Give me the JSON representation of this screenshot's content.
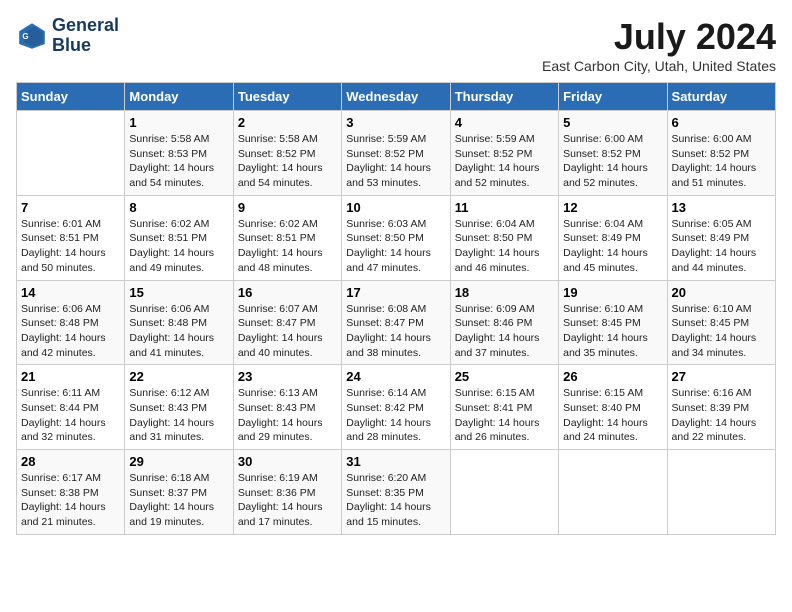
{
  "logo": {
    "line1": "General",
    "line2": "Blue"
  },
  "title": "July 2024",
  "location": "East Carbon City, Utah, United States",
  "days_header": [
    "Sunday",
    "Monday",
    "Tuesday",
    "Wednesday",
    "Thursday",
    "Friday",
    "Saturday"
  ],
  "weeks": [
    [
      {
        "num": "",
        "info": ""
      },
      {
        "num": "1",
        "info": "Sunrise: 5:58 AM\nSunset: 8:53 PM\nDaylight: 14 hours\nand 54 minutes."
      },
      {
        "num": "2",
        "info": "Sunrise: 5:58 AM\nSunset: 8:52 PM\nDaylight: 14 hours\nand 54 minutes."
      },
      {
        "num": "3",
        "info": "Sunrise: 5:59 AM\nSunset: 8:52 PM\nDaylight: 14 hours\nand 53 minutes."
      },
      {
        "num": "4",
        "info": "Sunrise: 5:59 AM\nSunset: 8:52 PM\nDaylight: 14 hours\nand 52 minutes."
      },
      {
        "num": "5",
        "info": "Sunrise: 6:00 AM\nSunset: 8:52 PM\nDaylight: 14 hours\nand 52 minutes."
      },
      {
        "num": "6",
        "info": "Sunrise: 6:00 AM\nSunset: 8:52 PM\nDaylight: 14 hours\nand 51 minutes."
      }
    ],
    [
      {
        "num": "7",
        "info": "Sunrise: 6:01 AM\nSunset: 8:51 PM\nDaylight: 14 hours\nand 50 minutes."
      },
      {
        "num": "8",
        "info": "Sunrise: 6:02 AM\nSunset: 8:51 PM\nDaylight: 14 hours\nand 49 minutes."
      },
      {
        "num": "9",
        "info": "Sunrise: 6:02 AM\nSunset: 8:51 PM\nDaylight: 14 hours\nand 48 minutes."
      },
      {
        "num": "10",
        "info": "Sunrise: 6:03 AM\nSunset: 8:50 PM\nDaylight: 14 hours\nand 47 minutes."
      },
      {
        "num": "11",
        "info": "Sunrise: 6:04 AM\nSunset: 8:50 PM\nDaylight: 14 hours\nand 46 minutes."
      },
      {
        "num": "12",
        "info": "Sunrise: 6:04 AM\nSunset: 8:49 PM\nDaylight: 14 hours\nand 45 minutes."
      },
      {
        "num": "13",
        "info": "Sunrise: 6:05 AM\nSunset: 8:49 PM\nDaylight: 14 hours\nand 44 minutes."
      }
    ],
    [
      {
        "num": "14",
        "info": "Sunrise: 6:06 AM\nSunset: 8:48 PM\nDaylight: 14 hours\nand 42 minutes."
      },
      {
        "num": "15",
        "info": "Sunrise: 6:06 AM\nSunset: 8:48 PM\nDaylight: 14 hours\nand 41 minutes."
      },
      {
        "num": "16",
        "info": "Sunrise: 6:07 AM\nSunset: 8:47 PM\nDaylight: 14 hours\nand 40 minutes."
      },
      {
        "num": "17",
        "info": "Sunrise: 6:08 AM\nSunset: 8:47 PM\nDaylight: 14 hours\nand 38 minutes."
      },
      {
        "num": "18",
        "info": "Sunrise: 6:09 AM\nSunset: 8:46 PM\nDaylight: 14 hours\nand 37 minutes."
      },
      {
        "num": "19",
        "info": "Sunrise: 6:10 AM\nSunset: 8:45 PM\nDaylight: 14 hours\nand 35 minutes."
      },
      {
        "num": "20",
        "info": "Sunrise: 6:10 AM\nSunset: 8:45 PM\nDaylight: 14 hours\nand 34 minutes."
      }
    ],
    [
      {
        "num": "21",
        "info": "Sunrise: 6:11 AM\nSunset: 8:44 PM\nDaylight: 14 hours\nand 32 minutes."
      },
      {
        "num": "22",
        "info": "Sunrise: 6:12 AM\nSunset: 8:43 PM\nDaylight: 14 hours\nand 31 minutes."
      },
      {
        "num": "23",
        "info": "Sunrise: 6:13 AM\nSunset: 8:43 PM\nDaylight: 14 hours\nand 29 minutes."
      },
      {
        "num": "24",
        "info": "Sunrise: 6:14 AM\nSunset: 8:42 PM\nDaylight: 14 hours\nand 28 minutes."
      },
      {
        "num": "25",
        "info": "Sunrise: 6:15 AM\nSunset: 8:41 PM\nDaylight: 14 hours\nand 26 minutes."
      },
      {
        "num": "26",
        "info": "Sunrise: 6:15 AM\nSunset: 8:40 PM\nDaylight: 14 hours\nand 24 minutes."
      },
      {
        "num": "27",
        "info": "Sunrise: 6:16 AM\nSunset: 8:39 PM\nDaylight: 14 hours\nand 22 minutes."
      }
    ],
    [
      {
        "num": "28",
        "info": "Sunrise: 6:17 AM\nSunset: 8:38 PM\nDaylight: 14 hours\nand 21 minutes."
      },
      {
        "num": "29",
        "info": "Sunrise: 6:18 AM\nSunset: 8:37 PM\nDaylight: 14 hours\nand 19 minutes."
      },
      {
        "num": "30",
        "info": "Sunrise: 6:19 AM\nSunset: 8:36 PM\nDaylight: 14 hours\nand 17 minutes."
      },
      {
        "num": "31",
        "info": "Sunrise: 6:20 AM\nSunset: 8:35 PM\nDaylight: 14 hours\nand 15 minutes."
      },
      {
        "num": "",
        "info": ""
      },
      {
        "num": "",
        "info": ""
      },
      {
        "num": "",
        "info": ""
      }
    ]
  ]
}
